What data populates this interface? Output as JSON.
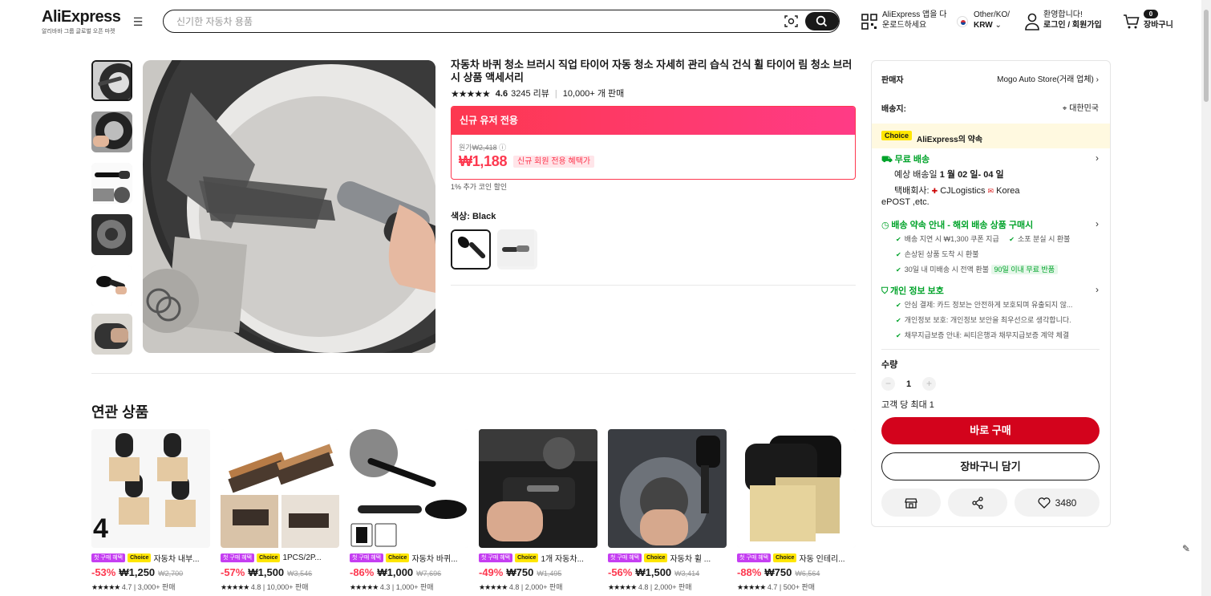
{
  "header": {
    "logo": "AliExpress",
    "logo_sub": "알리바바 그룹 글로벌 오픈 마켓",
    "menu_icon": "☰",
    "search_placeholder": "신기한 자동차 용품",
    "app_line1": "AliExpress 앱을 다",
    "app_line2": "운로드하세요",
    "locale_line1": "Other/KO/",
    "locale_line2": "KRW",
    "user_line1": "환영합니다!",
    "user_line2": "로그인 / 회원가입",
    "cart_count": "0",
    "cart_label": "장바구니"
  },
  "product": {
    "title": "자동차 바퀴 청소 브러시 직업 타이어 자동 청소 자세히 관리 습식 건식 휠 타이어 림 청소 브러시 상품 액세서리",
    "rating": "4.6",
    "reviews": "3245 리뷰",
    "sold": "10,000+ 개 판매",
    "promo_title": "신규 유저 전용",
    "orig_label": "원가",
    "orig_price": "₩2,418",
    "price": "₩1,188",
    "price_tag": "신규 회원 전용 혜택가",
    "coin_note": "1% 추가 코인 할인",
    "color_label": "색상: Black"
  },
  "related": {
    "title": "연관 상품",
    "first_tag": "첫 구매 혜택",
    "choice_tag": "Choice",
    "items": [
      {
        "name": "자동차 내부...",
        "discount": "-53%",
        "price": "₩1,250",
        "orig": "₩2,700",
        "rating": "4.7",
        "sold": "3,000+ 판매"
      },
      {
        "name": "1PCS/2P...",
        "discount": "-57%",
        "price": "₩1,500",
        "orig": "₩3,546",
        "rating": "4.8",
        "sold": "10,000+ 판매"
      },
      {
        "name": "자동차 바퀴...",
        "discount": "-86%",
        "price": "₩1,000",
        "orig": "₩7,696",
        "rating": "4.3",
        "sold": "1,000+ 판매"
      },
      {
        "name": "1개 자동차...",
        "discount": "-49%",
        "price": "₩750",
        "orig": "₩1,495",
        "rating": "4.8",
        "sold": "2,000+ 판매"
      },
      {
        "name": "자동차 휠 ...",
        "discount": "-56%",
        "price": "₩1,500",
        "orig": "₩3,414",
        "rating": "4.8",
        "sold": "2,000+ 판매"
      },
      {
        "name": "자동 인테리...",
        "discount": "-88%",
        "price": "₩750",
        "orig": "₩6,564",
        "rating": "4.7",
        "sold": "500+ 판매"
      }
    ]
  },
  "panel": {
    "seller_label": "판매자",
    "seller": "Mogo Auto Store(거래 업체)",
    "ship_label": "배송지:",
    "ship_to": "대한민국",
    "choice_badge": "Choice",
    "choice_promise": "AliExpress의 약속",
    "free_ship": "무료 배송",
    "eta_prefix": "예상 배송일",
    "eta": "1 월 02 일- 04 일",
    "carrier_prefix": "택배회사:",
    "carrier1": "CJLogistics",
    "carrier2": "Korea",
    "carrier3": "ePOST ,etc.",
    "delivery_title": "배송 약속 안내 - 해외 배송 상품 구매시",
    "d1": "배송 지연 시 ₩1,300 쿠폰 지급",
    "d2": "소포 분실 시 환불",
    "d3": "손상된 상품 도착 시 환불",
    "d4": "30일 내 미배송 시 전액 환불",
    "d4_badge": "90일 이내 무료 반품",
    "privacy_title": "개인 정보 보호",
    "p1": "안심 결제: 카드 정보는 안전하게 보호되며 유출되지 않...",
    "p2": "개인정보 보호: 개인정보 보안을 최우선으로 생각합니다.",
    "p3": "채무지급보증 안내: 씨티은행과 채무지급보증 계약 체결",
    "qty_label": "수량",
    "qty": "1",
    "limit": "고객 당 최대 1",
    "buy": "바로 구매",
    "add_cart": "장바구니 담기",
    "wish_count": "3480"
  }
}
